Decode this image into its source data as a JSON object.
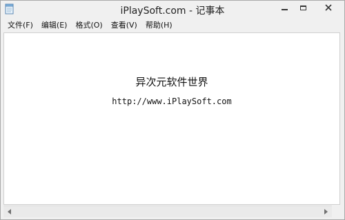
{
  "window": {
    "title": "iPlaySoft.com - 记事本"
  },
  "menu": {
    "items": [
      {
        "label": "文件(F)"
      },
      {
        "label": "编辑(E)"
      },
      {
        "label": "格式(O)"
      },
      {
        "label": "查看(V)"
      },
      {
        "label": "帮助(H)"
      }
    ]
  },
  "editor": {
    "line1": "异次元软件世界",
    "line2": "http://www.iPlaySoft.com"
  },
  "icons": {
    "app": "notepad-icon",
    "minimize": "minimize-icon",
    "maximize": "maximize-icon",
    "close": "close-icon",
    "scroll_left": "chevron-left-icon",
    "scroll_right": "chevron-right-icon"
  },
  "colors": {
    "chrome": "#f0f0f0",
    "editor_bg": "#ffffff",
    "text": "#111111"
  }
}
